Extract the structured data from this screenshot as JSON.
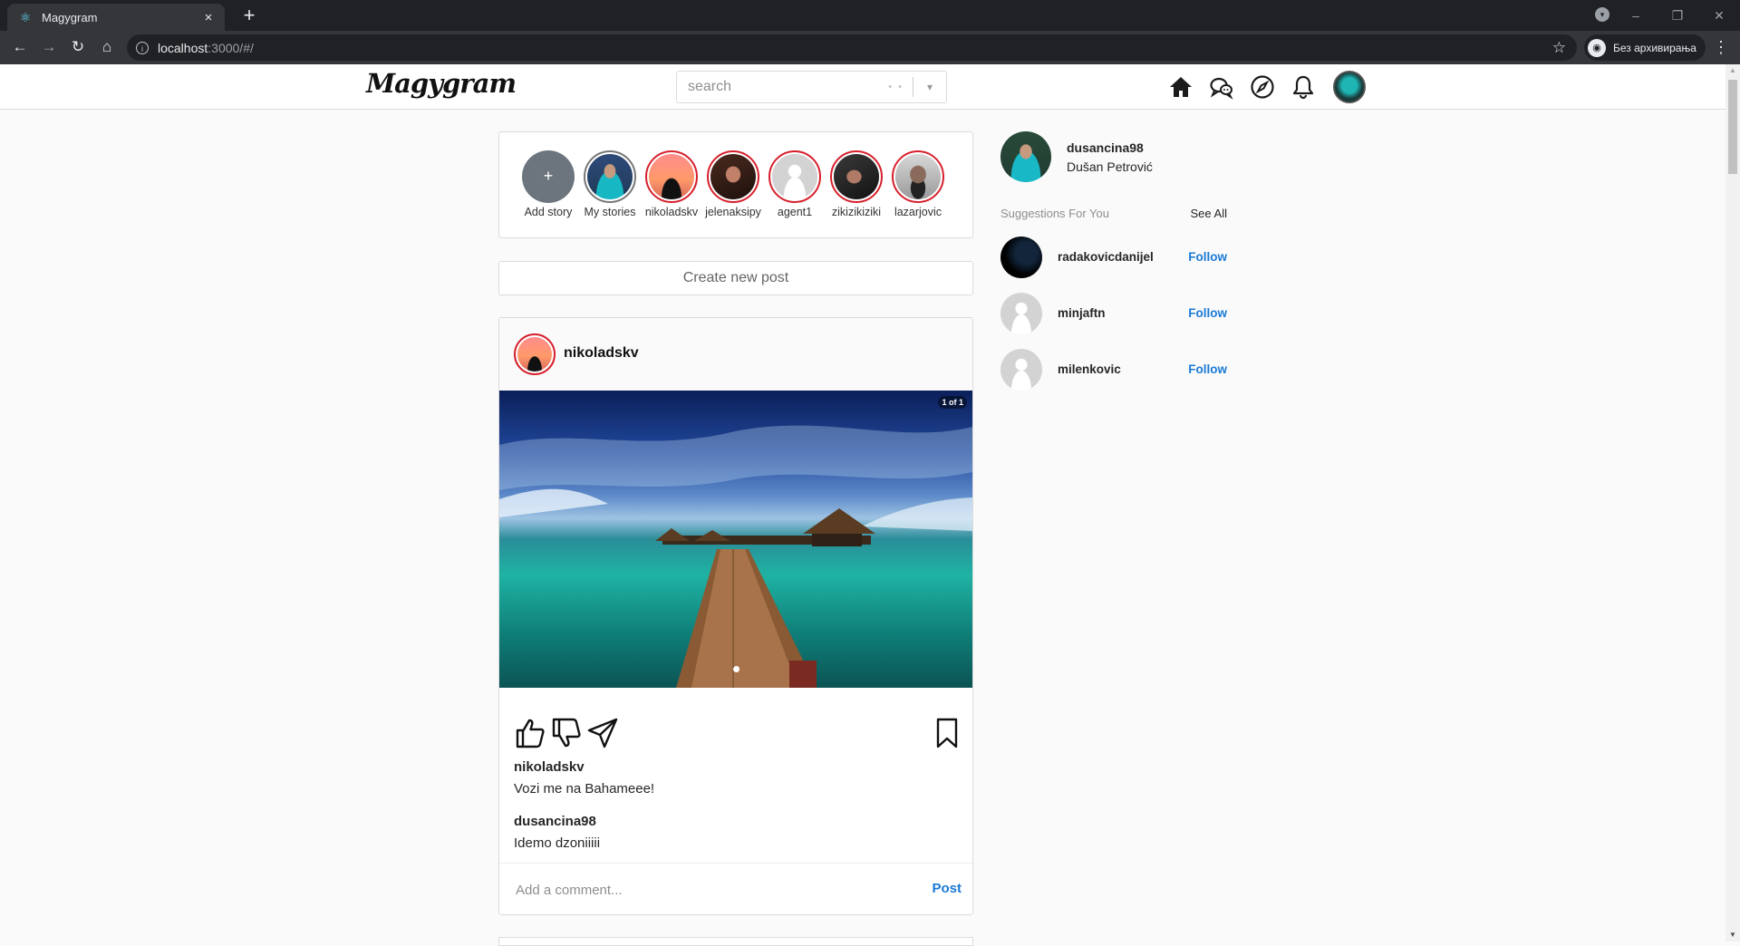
{
  "browser": {
    "tab_title": "Magygram",
    "tab_close": "×",
    "new_tab": "+",
    "url_host": "localhost",
    "url_path": ":3000/#/",
    "profile_label": "Без архивирања",
    "minimize": "–",
    "maximize": "❐",
    "close": "✕"
  },
  "header": {
    "logo": "Magygram",
    "search_placeholder": "search",
    "search_value": ""
  },
  "stories": [
    {
      "name": "Add story",
      "symbol": "+"
    },
    {
      "name": "My stories"
    },
    {
      "name": "nikoladskv"
    },
    {
      "name": "jelenaksipy"
    },
    {
      "name": "agent1"
    },
    {
      "name": "zikizikiziki"
    },
    {
      "name": "lazarjovic"
    }
  ],
  "create_post": "Create new post",
  "post": {
    "username": "nikoladskv",
    "image_counter": "1 of 1",
    "caption_user": "nikoladskv",
    "caption_text": "Vozi me na Bahameee!",
    "comment_user": "dusancina98",
    "comment_text": "Idemo dzoniiiii",
    "comment_placeholder": "Add a comment...",
    "post_button": "Post"
  },
  "sidebar": {
    "username": "dusancina98",
    "full_name": "Dušan Petrović",
    "suggestions_title": "Suggestions For You",
    "see_all": "See All",
    "suggestions": [
      {
        "username": "radakovicdanijel",
        "follow": "Follow"
      },
      {
        "username": "minjaftn",
        "follow": "Follow"
      },
      {
        "username": "milenkovic",
        "follow": "Follow"
      }
    ]
  },
  "colors": {
    "accent_link": "#1a7ad6",
    "story_ring": "#d6202d",
    "browser_dark": "#202124"
  },
  "icons": [
    "react-icon",
    "back-arrow-icon",
    "forward-arrow-icon",
    "reload-icon",
    "home-icon",
    "info-icon",
    "star-icon",
    "incognito-icon",
    "kebab-menu-icon",
    "chat-icon",
    "compass-icon",
    "bell-icon",
    "thumbs-up-icon",
    "thumbs-down-icon",
    "send-icon",
    "bookmark-icon",
    "chevron-down-icon"
  ]
}
